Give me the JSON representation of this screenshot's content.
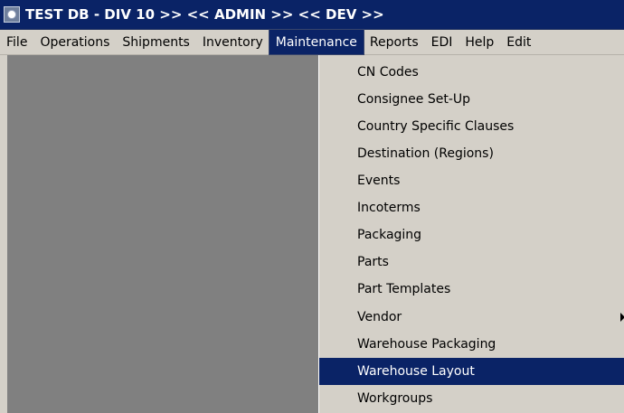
{
  "window": {
    "title": "TEST DB - DIV 10 >> << ADMIN >> << DEV >>",
    "icon": "app-icon"
  },
  "menubar": {
    "items": [
      {
        "label": "File"
      },
      {
        "label": "Operations"
      },
      {
        "label": "Shipments"
      },
      {
        "label": "Inventory"
      },
      {
        "label": "Maintenance",
        "active": true
      },
      {
        "label": "Reports"
      },
      {
        "label": "EDI"
      },
      {
        "label": "Help"
      },
      {
        "label": "Edit"
      }
    ]
  },
  "maintenance_menu": {
    "items": [
      {
        "label": "CN Codes"
      },
      {
        "label": "Consignee Set-Up"
      },
      {
        "label": "Country Specific Clauses"
      },
      {
        "label": "Destination (Regions)"
      },
      {
        "label": "Events"
      },
      {
        "label": "Incoterms"
      },
      {
        "label": "Packaging"
      },
      {
        "label": "Parts"
      },
      {
        "label": "Part Templates"
      },
      {
        "label": "Vendor",
        "has_submenu": true,
        "submenu_icon": "submenu-arrow-icon"
      },
      {
        "label": "Warehouse Packaging"
      },
      {
        "label": "Warehouse Layout",
        "selected": true
      },
      {
        "label": "Workgroups"
      }
    ]
  },
  "colors": {
    "titlebar": "#0a2366",
    "menu_background": "#d4d0c8",
    "workspace": "#808080",
    "highlight": "#0a2366"
  }
}
